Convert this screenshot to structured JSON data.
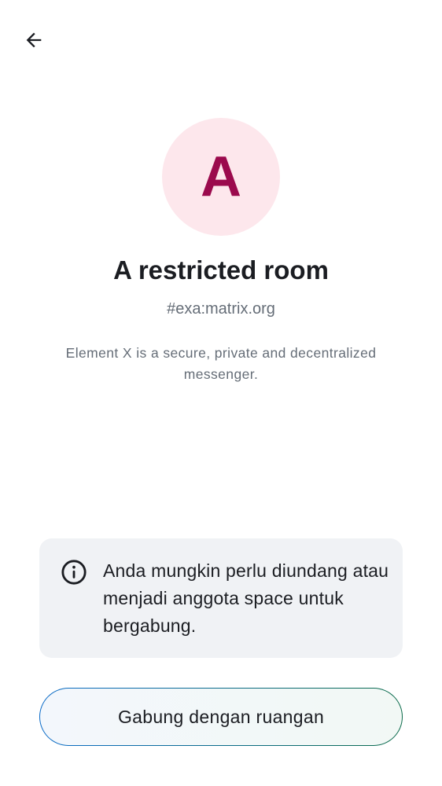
{
  "header": {
    "back_icon": "arrow-left-icon"
  },
  "room": {
    "avatar_letter": "A",
    "avatar_bg": "#fde7ec",
    "avatar_fg": "#9b0a4d",
    "title": "A restricted room",
    "alias": "#exa:matrix.org",
    "description": "Element X is a secure, private and decentralized messenger."
  },
  "notice": {
    "icon": "info-icon",
    "text": "Anda mungkin perlu diundang atau menjadi anggota space untuk bergabung."
  },
  "actions": {
    "join_label": "Gabung dengan ruangan"
  }
}
